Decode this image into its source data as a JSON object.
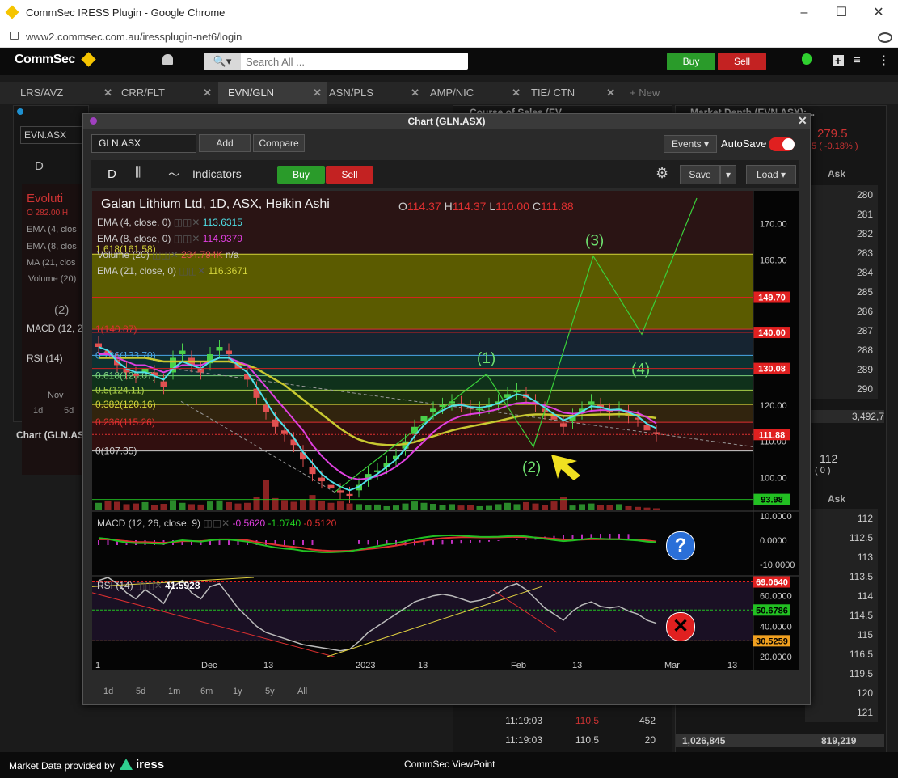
{
  "browser": {
    "title": "CommSec IRESS Plugin - Google Chrome",
    "url": "www2.commsec.com.au/iressplugin-net6/login",
    "min_icon": "–",
    "max_icon": "☐",
    "close_icon": "✕"
  },
  "topbar": {
    "logo": "CommSec",
    "search_placeholder": "Search All ...",
    "buy_label": "Buy",
    "sell_label": "Sell"
  },
  "tabs": [
    {
      "label": "LRS/AVZ"
    },
    {
      "label": "CRR/FLT"
    },
    {
      "label": "EVN/GLN"
    },
    {
      "label": "ASN/PLS"
    },
    {
      "label": "AMP/NIC"
    },
    {
      "label": "TIE/ CTN"
    },
    {
      "label": "+ New"
    }
  ],
  "bg_panels": {
    "left_title": "Chart (EVN.ASX)",
    "left_symbol": "EVN.ASX",
    "left_d": "D",
    "left_legend": [
      "Evoluti",
      "O 282.00 H",
      "EMA (4, clos",
      "EMA (8, clos",
      "MA (21, clos",
      "Volume (20)",
      "(2)",
      "MACD (12, 2",
      "RSI (14)"
    ],
    "left_nov": "Nov",
    "left_1d": "1d",
    "left_5d": "5d",
    "left_bottom_title": "Chart (GLN.ASX)",
    "cos_title": "Course of Sales (EV...",
    "depth_title": "Market Depth (EVN.ASX):...",
    "depth_price": "279.5",
    "depth_change": ".5 ( -0.18% )",
    "ask_header": "Ask",
    "ask_values": [
      "280",
      "281",
      "282",
      "283",
      "284",
      "285",
      "286",
      "287",
      "288",
      "289",
      "290"
    ],
    "depth_total": "3,492,7",
    "depth2_price": "112",
    "depth2_sub": "( 0 )",
    "ask2_values": [
      "112",
      "112.5",
      "113",
      "113.5",
      "114",
      "114.5",
      "115",
      "116.5",
      "119.5",
      "120",
      "121"
    ],
    "cos_rows": [
      {
        "time": "11:19:03",
        "price": "110.5",
        "vol": "452"
      },
      {
        "time": "11:19:03",
        "price": "110.5",
        "vol": "20"
      }
    ],
    "bottom_totals": [
      "1,026,845",
      "819,219"
    ]
  },
  "chart_window": {
    "title": "Chart (GLN.ASX)",
    "symbol": "GLN.ASX",
    "add_label": "Add",
    "compare_label": "Compare",
    "events_label": "Events",
    "autosave_label": "AutoSave",
    "interval": "D",
    "indicators_label": "Indicators",
    "buy_label": "Buy",
    "sell_label": "Sell",
    "save_label": "Save",
    "load_label": "Load",
    "range_buttons": [
      "1d",
      "5d",
      "1m",
      "6m",
      "1y",
      "5y",
      "All"
    ]
  },
  "chart_data": {
    "type": "line",
    "title": "Galan Lithium Ltd, 1D, ASX, Heikin Ashi",
    "ohlc": {
      "O": "114.37",
      "H": "114.37",
      "L": "110.00",
      "C": "111.88"
    },
    "legend": [
      {
        "name": "EMA (4, close, 0)",
        "value": "113.6315",
        "color": "#4fe0e8"
      },
      {
        "name": "EMA (8, close, 0)",
        "value": "114.9379",
        "color": "#e040e0"
      },
      {
        "name": "Volume (20)",
        "value": "234.794K",
        "extra": "n/a",
        "color": "#e05050"
      },
      {
        "name": "EMA (21, close, 0)",
        "value": "116.3671",
        "color": "#d4d43a"
      }
    ],
    "fib_levels": [
      {
        "label": "1.618(161.58)",
        "value": 161.58
      },
      {
        "label": "1(140.87)",
        "value": 140.87
      },
      {
        "label": "0.786(133.70)",
        "value": 133.7
      },
      {
        "label": "0.618(128.07)",
        "value": 128.07
      },
      {
        "label": "0.5(124.11)",
        "value": 124.11
      },
      {
        "label": "0.382(120.16)",
        "value": 120.16
      },
      {
        "label": "0.236(115.26)",
        "value": 115.26
      },
      {
        "label": "0(107.35)",
        "value": 107.35
      }
    ],
    "price_axis": {
      "ticks": [
        "170.00",
        "160.00",
        "150.00",
        "140.00",
        "130.00",
        "120.00",
        "110.00",
        "100.00"
      ],
      "ylim": [
        91,
        179
      ]
    },
    "price_tags": [
      {
        "label": "149.70",
        "value": 149.7,
        "color": "#e02020"
      },
      {
        "label": "140.00",
        "value": 140.0,
        "color": "#e02020"
      },
      {
        "label": "130.08",
        "value": 130.08,
        "color": "#e02020"
      },
      {
        "label": "111.88",
        "value": 111.88,
        "color": "#e02020"
      },
      {
        "label": "93.98",
        "value": 93.98,
        "color": "#22c022"
      }
    ],
    "wave_labels": [
      "(1)",
      "(2)",
      "(3)",
      "(4)"
    ],
    "x_ticks": [
      "1",
      "Dec",
      "13",
      "2023",
      "13",
      "Feb",
      "13",
      "Mar",
      "13"
    ],
    "close_series": [
      136,
      134,
      131,
      129,
      128,
      130,
      128,
      125,
      133,
      135,
      131,
      129,
      134,
      136,
      134,
      130,
      127,
      122,
      118,
      114,
      112,
      109,
      105,
      101,
      99,
      97,
      96,
      95,
      98,
      101,
      102,
      104,
      106,
      110,
      114,
      117,
      119,
      120,
      121,
      120,
      119,
      119,
      120,
      121,
      123,
      124,
      122,
      120,
      118,
      116,
      114,
      117,
      119,
      121,
      119,
      118,
      119,
      117,
      116,
      113,
      112
    ],
    "ema4": [
      136,
      135,
      132,
      130,
      129,
      129,
      128,
      127,
      130,
      132,
      131,
      130,
      132,
      133,
      133,
      131,
      129,
      125,
      121,
      117,
      114,
      111,
      107,
      104,
      101,
      99,
      97.5,
      96.5,
      97.5,
      99.5,
      101,
      103,
      105,
      108,
      111.5,
      114.5,
      117,
      118.5,
      119.8,
      120,
      119.5,
      119.3,
      119.7,
      120.5,
      121.8,
      123,
      122.5,
      121,
      119.3,
      117.5,
      115.8,
      116.8,
      118.2,
      119.7,
      119.4,
      118.7,
      118.8,
      118,
      116.9,
      114.8,
      113.6
    ],
    "ema8": [
      134,
      134,
      133,
      132,
      131,
      131,
      130,
      129,
      130,
      131,
      131,
      131,
      132,
      133,
      133,
      132,
      131,
      128,
      125,
      122,
      119,
      116,
      113,
      109,
      106,
      103.5,
      101.5,
      100,
      99.5,
      99.8,
      100.4,
      101.5,
      103,
      105,
      107.5,
      110,
      112.5,
      114.5,
      116,
      117,
      117.5,
      117.8,
      118.3,
      118.9,
      119.8,
      120.5,
      120.7,
      120.5,
      119.9,
      119,
      117.9,
      117.6,
      117.8,
      118.4,
      118.6,
      118.6,
      118.6,
      118.3,
      117.8,
      116.6,
      114.9
    ],
    "ema21": [
      133,
      133,
      133,
      133,
      133,
      133,
      132.5,
      132,
      132,
      132,
      132,
      132,
      132,
      132,
      132,
      131.5,
      131,
      130,
      128.5,
      127,
      125.5,
      123.5,
      121.5,
      119.5,
      117.5,
      115.5,
      113.5,
      111.8,
      110.5,
      109.7,
      109.2,
      109,
      109,
      109.3,
      109.8,
      110.6,
      111.4,
      112.2,
      113,
      113.6,
      114.1,
      114.6,
      115.1,
      115.6,
      116.2,
      116.8,
      117.2,
      117.4,
      117.4,
      117.3,
      117,
      117,
      117.1,
      117.3,
      117.4,
      117.4,
      117.5,
      117.4,
      117.2,
      116.8,
      116.4
    ],
    "volume": [
      22,
      28,
      25,
      18,
      20,
      24,
      16,
      19,
      30,
      22,
      18,
      17,
      26,
      29,
      24,
      20,
      22,
      40,
      90,
      36,
      30,
      25,
      33,
      45,
      28,
      22,
      26,
      20,
      18,
      15,
      17,
      12,
      14,
      20,
      26,
      22,
      19,
      16,
      18,
      14,
      15,
      12,
      13,
      18,
      22,
      18,
      24,
      20,
      16,
      26,
      40,
      14,
      18,
      20,
      16,
      15,
      18,
      12,
      10,
      8,
      6
    ],
    "macd": {
      "name": "MACD (12, 26, close, 9)",
      "values": [
        "-0.5620",
        "-1.0740",
        "-0.5120"
      ],
      "ticks": [
        "10.0000",
        "0.0000",
        "-10.0000"
      ]
    },
    "rsi": {
      "name": "RSI (14)",
      "value": "41.5928",
      "ticks": [
        "60.0000",
        "40.0000",
        "20.0000"
      ],
      "tags": [
        {
          "label": "69.0640",
          "value": 69.064,
          "color": "#e02020"
        },
        {
          "label": "50.6786",
          "value": 50.6786,
          "color": "#22c022"
        },
        {
          "label": "30.5259",
          "value": 30.5259,
          "color": "#f0a020"
        }
      ],
      "series": [
        70,
        72,
        68,
        62,
        58,
        64,
        60,
        55,
        66,
        70,
        62,
        58,
        66,
        68,
        60,
        52,
        46,
        40,
        36,
        34,
        32,
        30,
        28,
        27,
        26,
        25,
        24,
        25,
        30,
        36,
        40,
        44,
        48,
        52,
        56,
        58,
        60,
        61,
        60,
        58,
        56,
        57,
        59,
        62,
        66,
        68,
        64,
        58,
        52,
        48,
        44,
        50,
        54,
        56,
        53,
        52,
        53,
        50,
        48,
        44,
        42
      ]
    }
  },
  "footer": {
    "provider": "Market Data provided by",
    "brand": "iress",
    "center": "CommSec ViewPoint"
  }
}
